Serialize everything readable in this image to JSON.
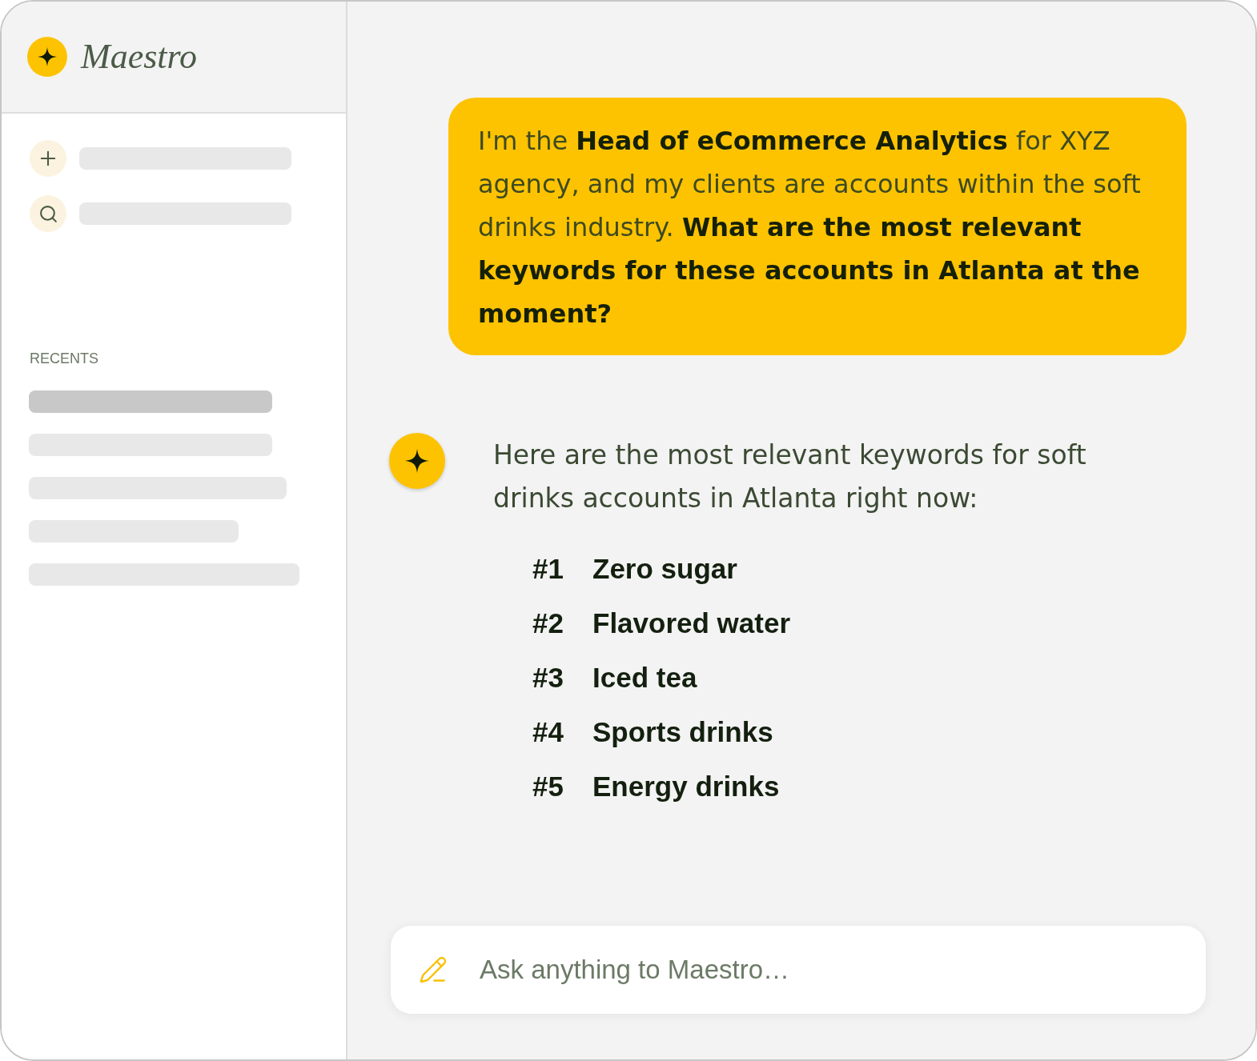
{
  "sidebar": {
    "brand": "Maestro",
    "actions": [
      {
        "kind": "new"
      },
      {
        "kind": "search"
      }
    ],
    "recents_heading": "RECENTS",
    "recents": [
      {
        "selected": true
      },
      {
        "selected": false
      },
      {
        "selected": false
      },
      {
        "selected": false
      },
      {
        "selected": false
      }
    ]
  },
  "chat": {
    "messages": [
      {
        "kind": "user",
        "text": "I'm the **Head of eCommerce Analytics** for XYZ agency, and my clients are accounts within the soft drinks industry. **What are the most relevant keywords for these accounts in Atlanta at the moment?**"
      },
      {
        "kind": "assistant",
        "text": "Here are the most relevant keywords for soft drinks accounts in Atlanta right now:",
        "list": [
          {
            "rank": "#1",
            "label": "Zero sugar"
          },
          {
            "rank": "#2",
            "label": "Flavored water"
          },
          {
            "rank": "#3",
            "label": "Iced tea"
          },
          {
            "rank": "#4",
            "label": "Sports drinks"
          },
          {
            "rank": "#5",
            "label": "Energy drinks"
          }
        ]
      }
    ]
  },
  "composer": {
    "placeholder": "Ask anything to Maestro…"
  }
}
